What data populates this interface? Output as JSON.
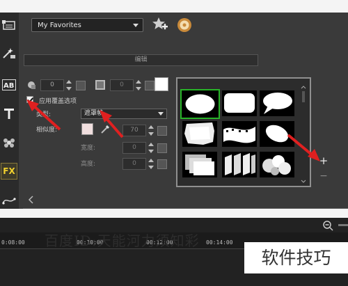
{
  "toolbar": {
    "favorites_select": "My Favorites",
    "edit_tab": "编辑",
    "fx_label": "FX"
  },
  "mask_options": {
    "shape_value": "0",
    "border_value": "0",
    "apply_overlay_label": "应用覆盖选项",
    "apply_overlay_checked": true,
    "type_label": "类型:",
    "type_value": "遮罩帧",
    "similarity_label": "相似度:",
    "similarity_value": "70",
    "width_label": "宽度:",
    "width_value": "0",
    "height_label": "高度:",
    "height_value": "0"
  },
  "mask_gallery": {
    "items": [
      "oval",
      "rounded-rect",
      "speech-bubble",
      "torn-paper",
      "film-strip",
      "tilted-oval",
      "stacked-frames",
      "slanted-bars",
      "bubbles"
    ],
    "selected": 0
  },
  "timeline": {
    "timecodes": [
      "0:08:00",
      "00:10:00",
      "00:12:00",
      "00:14:00"
    ]
  },
  "overlays": {
    "watermark": "百度ID:天能河力须知彩",
    "logo_text": "软件技巧"
  },
  "colors": {
    "panel_bg": "#3a3a3a",
    "selection_green": "#28b428",
    "arrow_red": "#e02020"
  }
}
